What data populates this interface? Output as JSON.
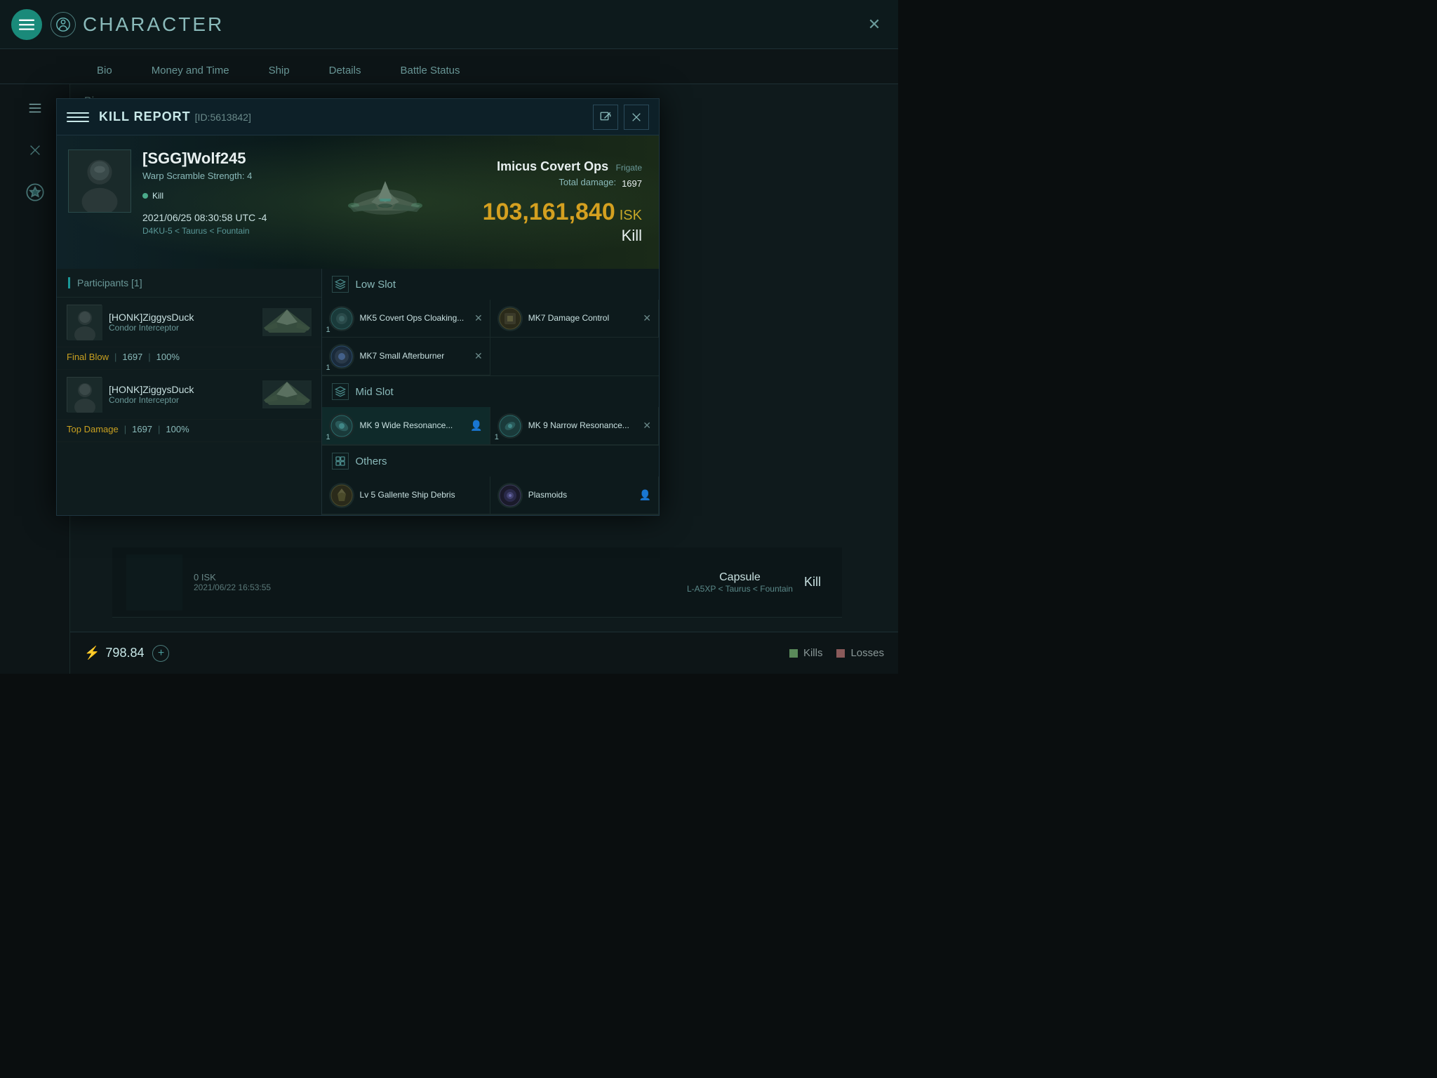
{
  "window": {
    "title": "CHARACTER",
    "close_label": "×"
  },
  "tabs": [
    {
      "id": "bio",
      "label": "Bio",
      "active": false
    },
    {
      "id": "money",
      "label": "Money and Time",
      "active": false
    },
    {
      "id": "ship",
      "label": "Ship",
      "active": false
    },
    {
      "id": "details",
      "label": "Details",
      "active": false
    },
    {
      "id": "battle",
      "label": "Battle Status",
      "active": false
    }
  ],
  "kill_report": {
    "title": "KILL REPORT",
    "id": "[ID:5613842]",
    "pilot": {
      "name": "[SGG]Wolf245",
      "warp_strength": "Warp Scramble Strength: 4"
    },
    "kill_badge": "Kill",
    "timestamp": "2021/06/25 08:30:58 UTC -4",
    "location": "D4KU-5 < Taurus < Fountain",
    "ship": {
      "name": "Imicus Covert Ops",
      "type": "Frigate",
      "total_damage_label": "Total damage:",
      "total_damage_value": "1697",
      "isk_value": "103,161,840",
      "isk_currency": "ISK",
      "kill_type": "Kill"
    },
    "participants_header": "Participants [1]",
    "participants": [
      {
        "name": "[HONK]ZiggysDuck",
        "ship": "Condor Interceptor",
        "stat_label": "Final Blow",
        "damage": "1697",
        "percent": "100%"
      },
      {
        "name": "[HONK]ZiggysDuck",
        "ship": "Condor Interceptor",
        "stat_label": "Top Damage",
        "damage": "1697",
        "percent": "100%"
      }
    ],
    "slots": {
      "low": {
        "label": "Low Slot",
        "items": [
          {
            "name": "MK5 Covert Ops Cloaking...",
            "count": "1",
            "has_x": true,
            "highlighted": false
          },
          {
            "name": "MK7 Damage Control",
            "count": "",
            "has_x": true,
            "highlighted": false
          },
          {
            "name": "MK7 Small Afterburner",
            "count": "1",
            "has_x": true,
            "highlighted": false
          }
        ]
      },
      "mid": {
        "label": "Mid Slot",
        "items": [
          {
            "name": "MK 9 Wide Resonance...",
            "count": "1",
            "has_x": false,
            "highlighted": true,
            "has_person": true
          },
          {
            "name": "MK 9 Narrow Resonance...",
            "count": "1",
            "has_x": true,
            "highlighted": false
          }
        ]
      },
      "others": {
        "label": "Others",
        "items": [
          {
            "name": "Lv 5 Gallente Ship Debris",
            "count": "",
            "has_x": false,
            "highlighted": false
          },
          {
            "name": "Plasmoids",
            "count": "",
            "has_x": false,
            "highlighted": false,
            "has_person": true
          }
        ]
      }
    }
  },
  "background_entry": {
    "isk": "0 ISK",
    "timestamp": "2021/06/22  16:53:55",
    "ship": "Capsule",
    "location": "L-A5XP < Taurus < Fountain",
    "type": "Kill"
  },
  "bottom_bar": {
    "stat_value": "798.84",
    "kills_label": "Kills",
    "losses_label": "Losses"
  }
}
